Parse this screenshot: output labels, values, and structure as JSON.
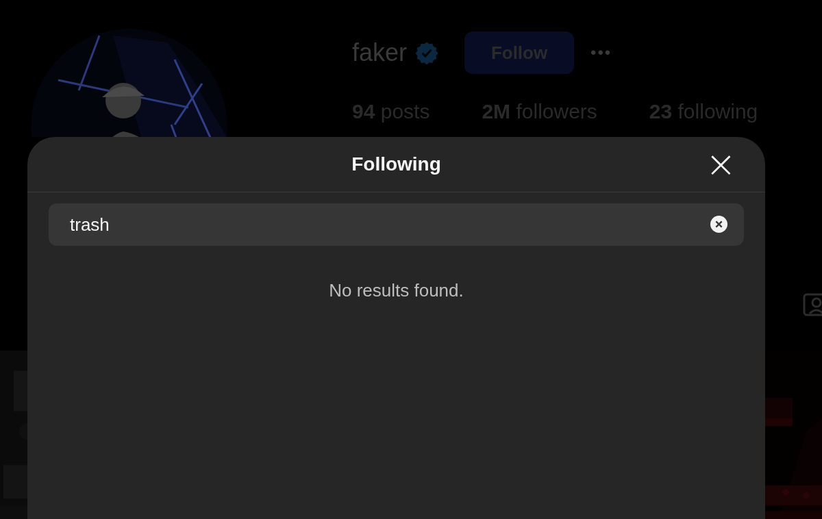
{
  "profile": {
    "username": "faker",
    "verified": true,
    "follow_button": "Follow",
    "more_button": "•••",
    "stats": [
      "**94** posts",
      "**2M** followers",
      "**23** following"
    ]
  },
  "dialog": {
    "title": "Following",
    "close": "×",
    "search": {
      "value": "trash"
    },
    "empty_message": "No results found."
  }
}
